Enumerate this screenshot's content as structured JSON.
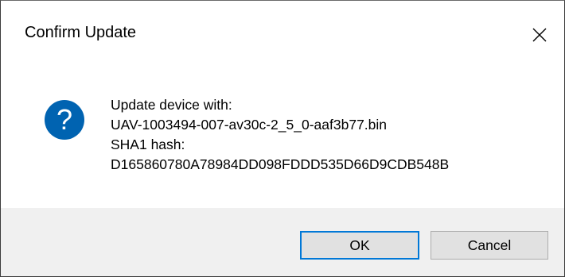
{
  "dialog": {
    "title": "Confirm Update",
    "close_icon": "close-icon",
    "icon": "question-icon",
    "accent_color": "#0063b1",
    "message_lines": [
      "Update device with:",
      "UAV-1003494-007-av30c-2_5_0-aaf3b77.bin",
      "SHA1 hash:",
      "D165860780A78984DD098FDDD535D66D9CDB548B"
    ],
    "buttons": {
      "ok_label": "OK",
      "cancel_label": "Cancel"
    }
  }
}
